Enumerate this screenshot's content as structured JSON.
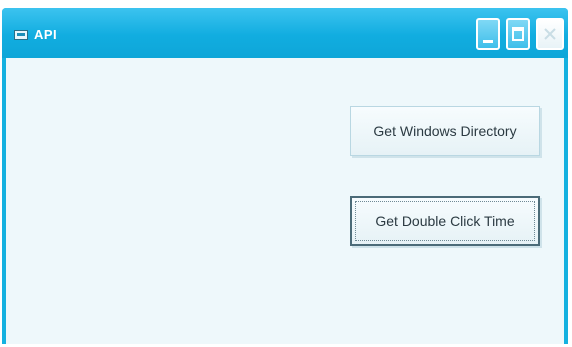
{
  "window": {
    "title": "API"
  },
  "buttons": {
    "get_windows_directory": "Get Windows Directory",
    "get_double_click_time": "Get Double Click Time"
  },
  "theme": {
    "titlebar_color": "#14b1e0",
    "client_color": "#eef8fb"
  },
  "icons": {
    "app": "app-window-icon",
    "minimize": "minimize-icon",
    "maximize": "maximize-icon",
    "close": "close-icon"
  }
}
